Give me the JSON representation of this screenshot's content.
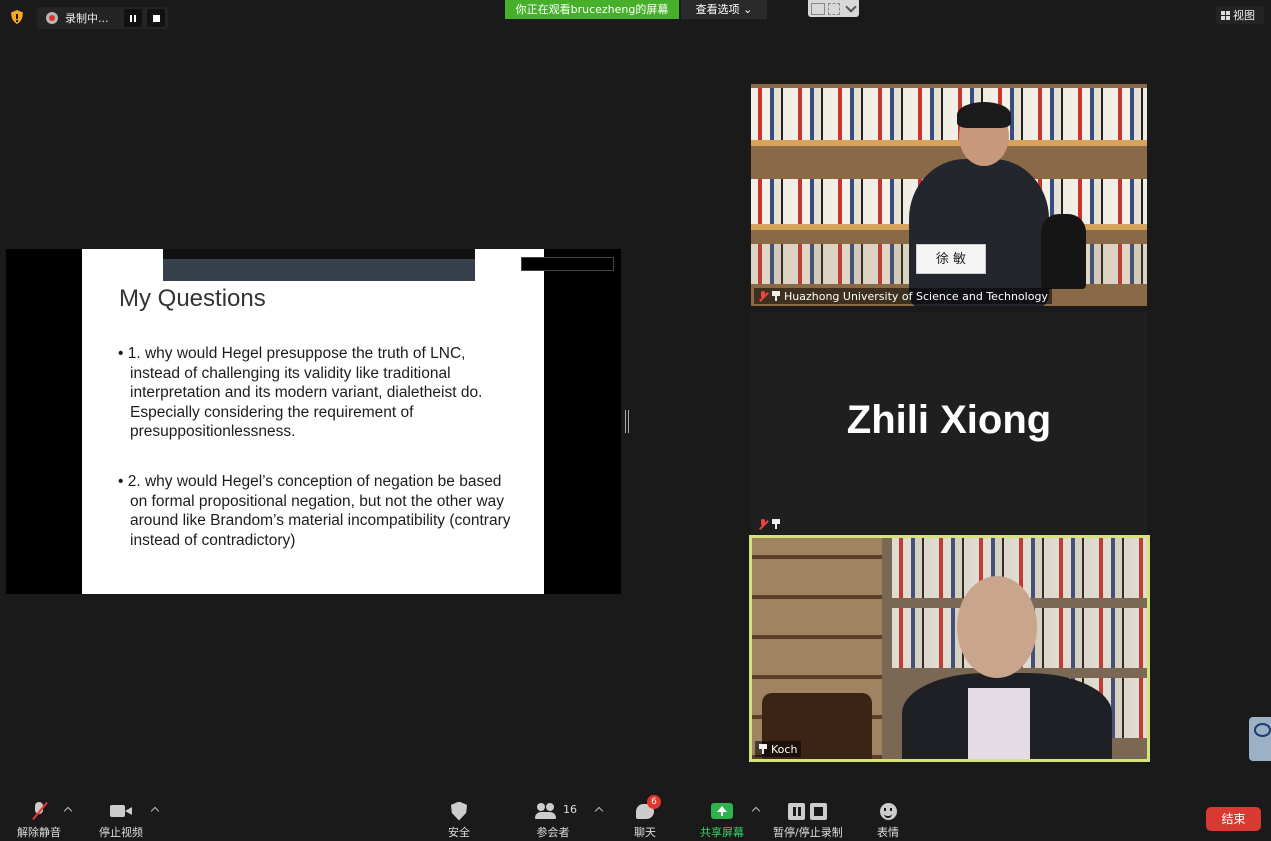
{
  "top_bar": {
    "recording_label": "录制中...",
    "viewing_banner": "你正在观看brucezheng的屏幕",
    "view_options": "查看选项",
    "view_label": "视图"
  },
  "slide": {
    "title": "My Questions",
    "bullets": [
      "1. why would Hegel presuppose the truth of LNC, instead of challenging its validity like traditional interpretation and its modern variant, dialetheist do. Especially considering the requirement of presuppositionlessness.",
      "2. why would Hegel’s conception of negation be based on formal propositional negation, but not the other way around like Brandom’s material incompatibility (contrary instead of contradictory)"
    ]
  },
  "participants": [
    {
      "name": "Huazhong University of Science and Technology",
      "placard": "徐 敏",
      "muted": true,
      "pinned": true
    },
    {
      "name": "Zhili Xiong",
      "muted": true,
      "pinned": true,
      "video": false
    },
    {
      "name": "Koch",
      "muted": false,
      "pinned": true,
      "active_speaker": true
    }
  ],
  "toolbar": {
    "unmute": "解除静音",
    "stop_video": "停止视频",
    "security": "安全",
    "participants": "参会者",
    "participant_count": "16",
    "chat": "聊天",
    "chat_unread": "6",
    "share_screen": "共享屏幕",
    "pause_stop_recording": "暂停/停止录制",
    "reactions": "表情",
    "end": "结束"
  },
  "colors": {
    "banner_green": "#46b02a",
    "active_speaker_border": "#d7e27a",
    "end_red": "#d83a33",
    "share_green": "#2fb14e"
  }
}
